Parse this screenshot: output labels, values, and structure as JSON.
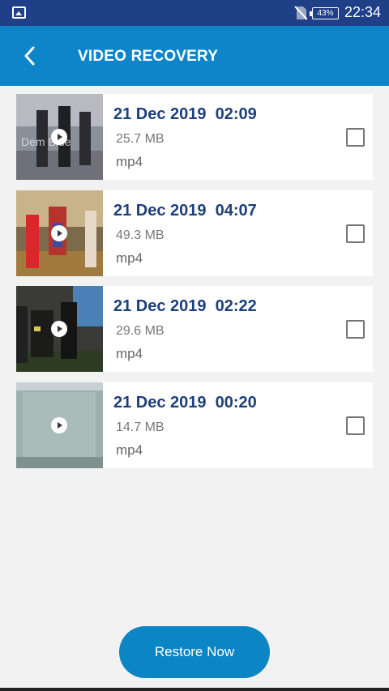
{
  "status_bar": {
    "battery": "43%",
    "time": "22:34",
    "icons": [
      "image-notification-icon",
      "no-sim-icon",
      "battery-icon"
    ]
  },
  "app_bar": {
    "title": "VIDEO RECOVERY",
    "back_icon": "chevron-left-icon"
  },
  "videos": [
    {
      "date": "21 Dec 2019  02:09",
      "size": "25.7 MB",
      "ext": "mp4",
      "thumb_watermark": "Dem Blue",
      "checked": false
    },
    {
      "date": "21 Dec 2019  04:07",
      "size": "49.3 MB",
      "ext": "mp4",
      "checked": false
    },
    {
      "date": "21 Dec 2019  02:22",
      "size": "29.6 MB",
      "ext": "mp4",
      "checked": false
    },
    {
      "date": "21 Dec 2019  00:20",
      "size": "14.7 MB",
      "ext": "mp4",
      "checked": false
    }
  ],
  "restore_button": {
    "label": "Restore Now"
  },
  "colors": {
    "status_bar": "#1f3f86",
    "app_bar": "#0d85c8",
    "date_text": "#1d3f7a",
    "button": "#0c85c4",
    "background": "#f2f2f2"
  }
}
